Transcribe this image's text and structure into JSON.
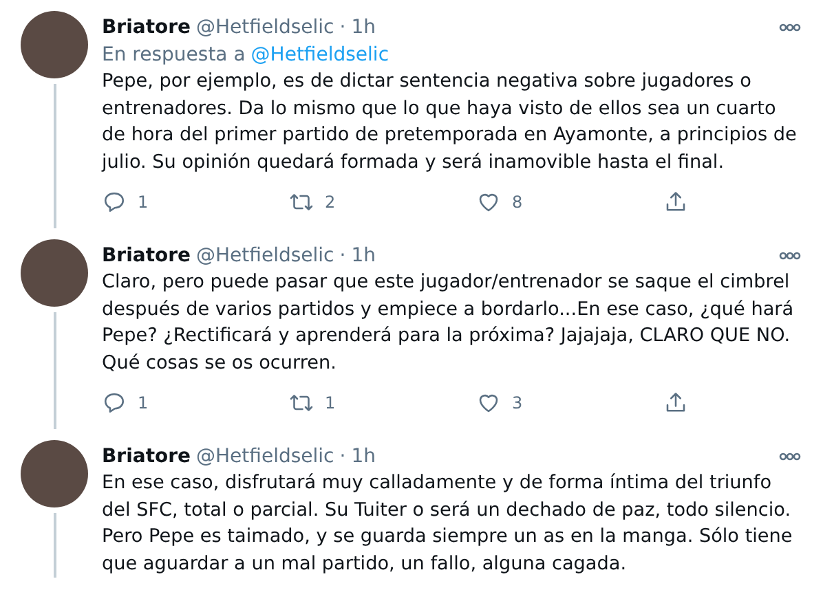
{
  "tweets": [
    {
      "name": "Briatore",
      "handle": "@Hetfieldselic",
      "separator": "·",
      "time": "1h",
      "reply_prefix": "En respuesta a",
      "reply_to": "@Hetfieldselic",
      "text": "Pepe, por ejemplo, es de dictar sentencia negativa sobre jugadores o entrenadores. Da lo mismo que lo que haya visto de ellos sea un cuarto de hora del primer partido de pretemporada en Ayamonte, a principios de julio. Su opinión quedará formada y será inamovible hasta el final.",
      "replies": "1",
      "retweets": "2",
      "likes": "8"
    },
    {
      "name": "Briatore",
      "handle": "@Hetfieldselic",
      "separator": "·",
      "time": "1h",
      "text": "Claro, pero puede pasar que este jugador/entrenador se saque el cimbrel después de varios partidos y empiece a bordarlo...En ese caso, ¿qué hará Pepe? ¿Rectificará y aprenderá para la próxima? Jajajaja, CLARO QUE NO. Qué cosas se os ocurren.",
      "replies": "1",
      "retweets": "1",
      "likes": "3"
    },
    {
      "name": "Briatore",
      "handle": "@Hetfieldselic",
      "separator": "·",
      "time": "1h",
      "text": "En ese caso, disfrutará muy calladamente y de forma íntima del triunfo del SFC, total o parcial. Su Tuiter o será un dechado de paz, todo silencio. Pero Pepe es taimado, y se guarda siempre un as en la manga. Sólo tiene que aguardar a un mal partido, un fallo, alguna cagada."
    }
  ]
}
